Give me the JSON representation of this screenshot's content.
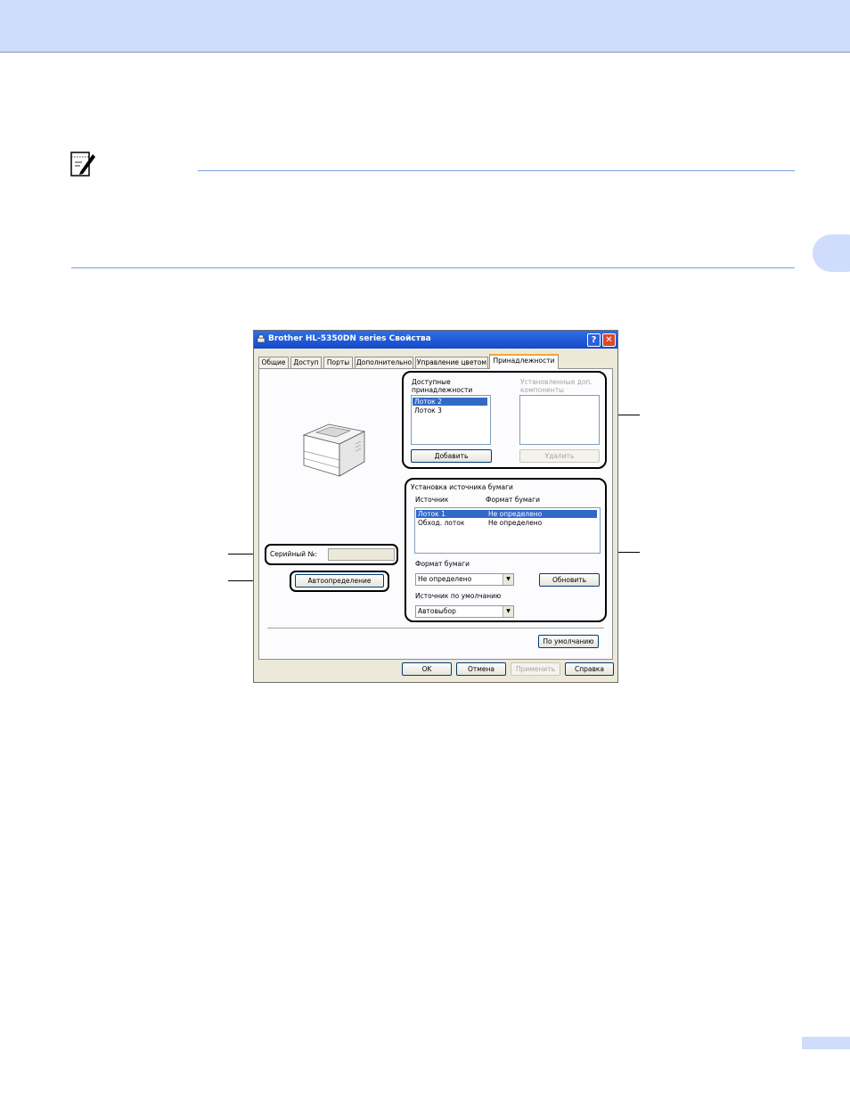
{
  "dialog": {
    "title": "Brother HL-5350DN series Свойства",
    "help_glyph": "?",
    "close_glyph": "✕",
    "tabs": [
      {
        "label": "Общие"
      },
      {
        "label": "Доступ"
      },
      {
        "label": "Порты"
      },
      {
        "label": "Дополнительно"
      },
      {
        "label": "Управление цветом"
      },
      {
        "label": "Принадлежности"
      }
    ],
    "active_tab": "Принадлежности",
    "available_options": {
      "label_line1": "Доступные",
      "label_line2": "принадлежности",
      "items": [
        "Лоток 2",
        "Лоток 3"
      ],
      "selected": "Лоток 2",
      "add_button": "Добавить"
    },
    "installed_options": {
      "label_line1": "Установленные доп.",
      "label_line2": "компоненты",
      "remove_button": "Удалить"
    },
    "paper_source": {
      "group_label": "Установка источника бумаги",
      "col_source": "Источник",
      "col_format": "Формат бумаги",
      "rows": [
        {
          "source": "Лоток 1",
          "format": "Не определено",
          "selected": true
        },
        {
          "source": "Обход. лоток",
          "format": "Не определено",
          "selected": false
        }
      ],
      "format_label": "Формат бумаги",
      "format_value": "Не определено",
      "update_button": "Обновить",
      "default_source_label": "Источник по умолчанию",
      "default_source_value": "Автовыбор"
    },
    "serial_label": "Серийный №:",
    "serial_value": "",
    "autodetect_button": "Автоопределение",
    "defaults_button": "По умолчанию",
    "ok_button": "OK",
    "cancel_button": "Отмена",
    "apply_button": "Применить",
    "help_button": "Справка"
  },
  "colors": {
    "header_band": "#cfdcfb",
    "rule": "#7ca0e0",
    "xp_title": "#1f5bd6",
    "selection": "#316ac5"
  }
}
